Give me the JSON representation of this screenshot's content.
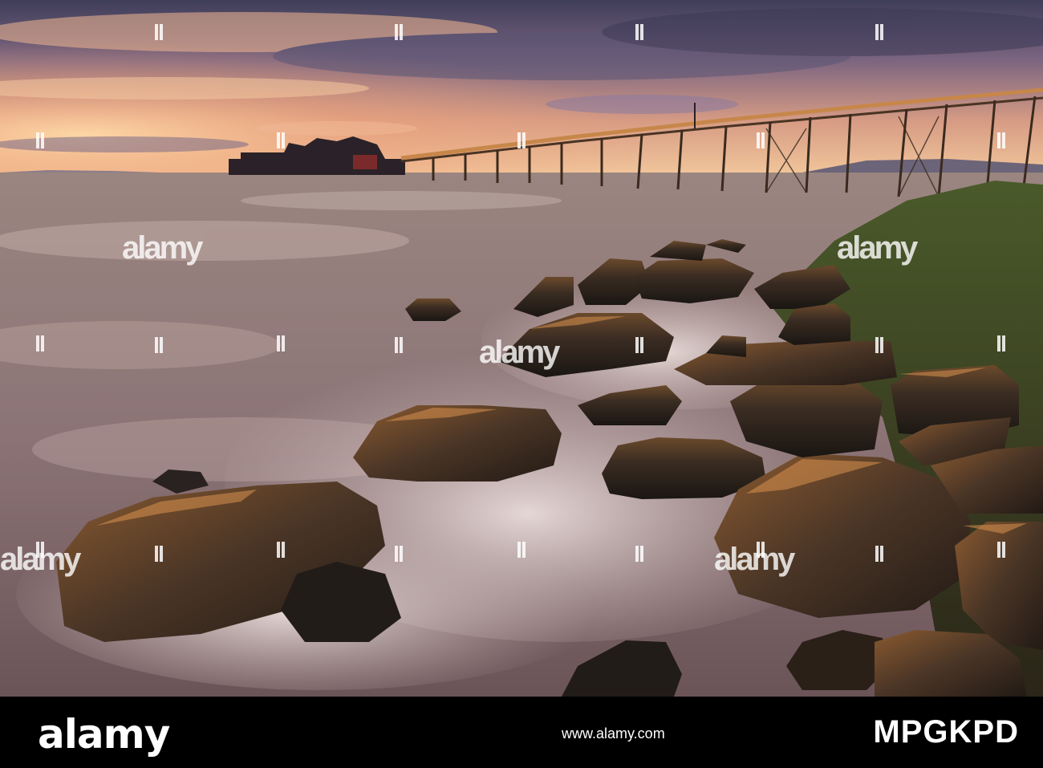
{
  "photo": {
    "subject": "Birnbeck pier at sunset with waves over rocks",
    "colors": {
      "sky_top": "#4a4a68",
      "sky_glow": "#f1b487",
      "sea": "#8a7374",
      "rock": "#2a2521",
      "foam": "#e9dcd8"
    }
  },
  "watermark": {
    "logo_text": "alamy",
    "icon": "alamy-watermark-icon"
  },
  "footer": {
    "logo_text": "alamy",
    "image_id": "MPGKPD",
    "site": "www.alamy.com"
  }
}
